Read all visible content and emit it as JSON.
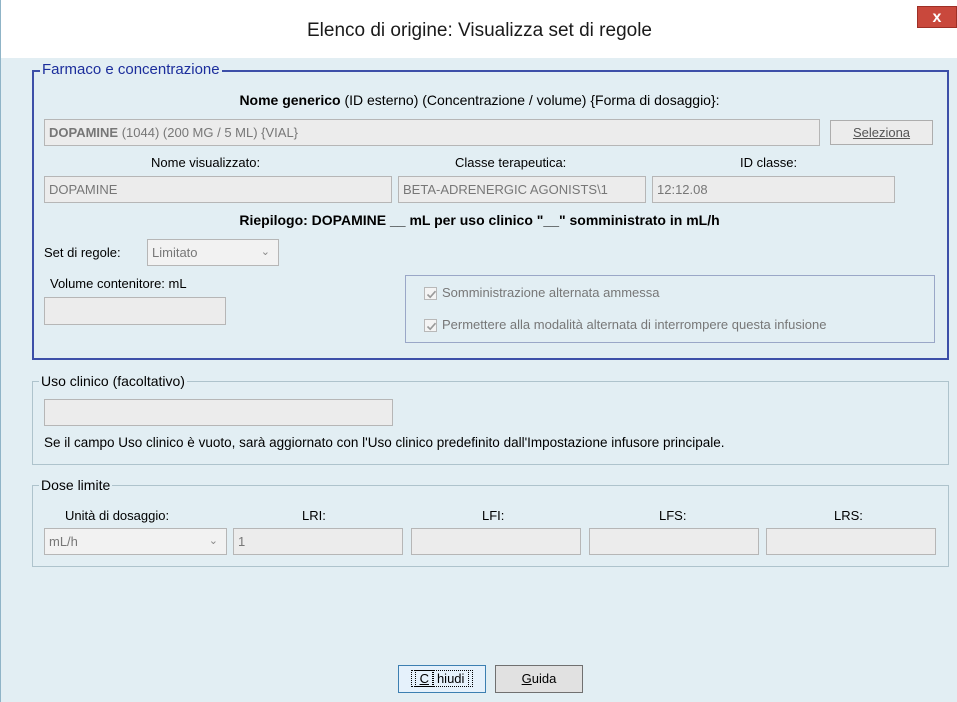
{
  "window": {
    "title": "Elenco di origine: Visualizza set di regole",
    "close_glyph": "x"
  },
  "drug_group": {
    "legend": "Farmaco e concentrazione",
    "header_bold": "Nome generico",
    "header_rest": " (ID esterno) (Concentrazione / volume) {Forma di dosaggio}:",
    "generic_name_bold": "DOPAMINE",
    "generic_name_rest": " (1044) (200 MG / 5 ML) {VIAL}",
    "select_button": "Seleziona",
    "display_name_label": "Nome visualizzato:",
    "display_name_value": "DOPAMINE",
    "therapeutic_class_label": "Classe terapeutica:",
    "therapeutic_class_value": "BETA-ADRENERGIC AGONISTS\\1",
    "class_id_label": "ID classe:",
    "class_id_value": "12:12.08",
    "summary": "Riepilogo: DOPAMINE __ mL per uso clinico \"__\" somministrato in mL/h",
    "ruleset_label": "Set di regole:",
    "ruleset_value": "Limitato",
    "container_volume_label": "Volume contenitore: mL",
    "container_volume_value": "",
    "piggyback_allowed_label": "Somministrazione alternata ammessa",
    "piggyback_allowed_checked": true,
    "piggyback_interrupt_label": "Permettere alla modalità alternata di interrompere questa infusione",
    "piggyback_interrupt_checked": true
  },
  "clinical_use_group": {
    "legend": "Uso clinico (facoltativo)",
    "value": "",
    "note": "Se il campo Uso clinico è vuoto, sarà aggiornato con l'Uso clinico predefinito dall'Impostazione infusore principale."
  },
  "dose_limits_group": {
    "legend": "Dose limite",
    "dosing_unit_label": "Unità di dosaggio:",
    "dosing_unit_value": "mL/h",
    "lri_label": "LRI:",
    "lri_value": "1",
    "lfi_label": "LFI:",
    "lfi_value": "",
    "lfs_label": "LFS:",
    "lfs_value": "",
    "lrs_label": "LRS:",
    "lrs_value": ""
  },
  "footer": {
    "close_button_underlined": "C",
    "close_button_rest": "hiudi",
    "help_button_underlined": "G",
    "help_button_rest": "uida"
  },
  "colors": {
    "accent_blue": "#1c2e9c",
    "close_red": "#c9483c",
    "background": "#e2eef3"
  }
}
